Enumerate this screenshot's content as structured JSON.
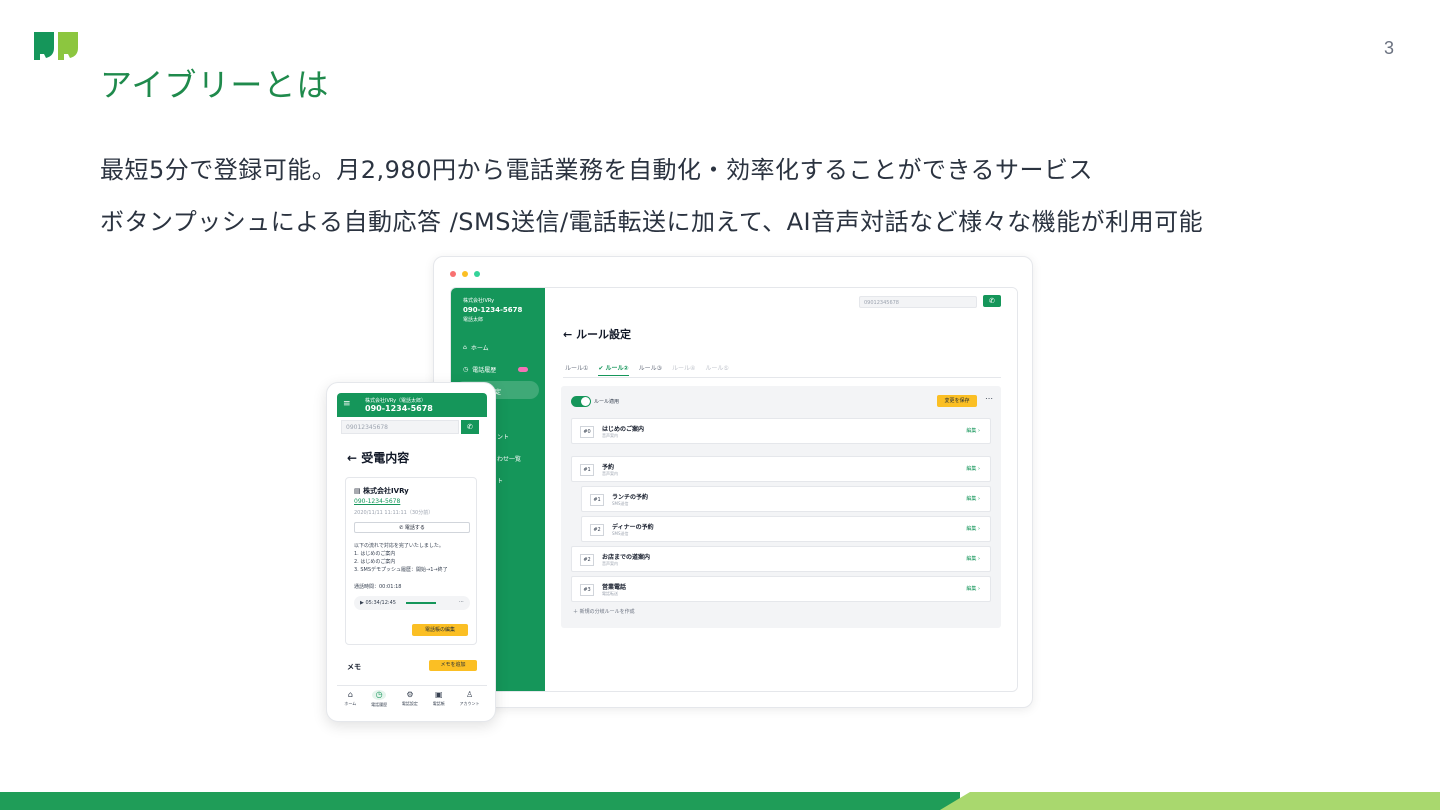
{
  "slide": {
    "page_number": "3",
    "title": "アイブリーとは",
    "line1": "最短5分で登録可能。月2,980円から電話業務を自動化・効率化することができるサービス",
    "line2": "ボタンプッシュによる自動応答 /SMS送信/電話転送に加えて、AI音声対話など様々な機能が利用可能"
  },
  "colors": {
    "brand_green": "#15965a",
    "title_green": "#1f8a4c",
    "accent_yellow": "#fbbf24",
    "footer_light": "#a9d86e"
  },
  "desktop": {
    "sidebar": {
      "company": "株式会社IVRy",
      "phone": "090-1234-5678",
      "user": "電話太郎",
      "items": [
        {
          "label": "ホーム",
          "icon": "home-icon"
        },
        {
          "label": "電話履歴",
          "icon": "clock-icon"
        },
        {
          "label": "定",
          "icon": "gear-icon"
        },
        {
          "label": "ント",
          "icon": ""
        },
        {
          "label": "わせ一覧",
          "icon": ""
        },
        {
          "label": "ト",
          "icon": ""
        }
      ]
    },
    "search_value": "09012345678",
    "page_title": "ルール設定",
    "tabs": [
      "ルール①",
      "ルール②",
      "ルール③",
      "ルール④",
      "ルール⑤"
    ],
    "toggle_label": "ルール適用",
    "save_label": "変更を保存",
    "edit_label": "編集",
    "rules": [
      {
        "num": "#0",
        "title": "はじめのご案内",
        "sub": "音声案内"
      },
      {
        "num": "#1",
        "title": "予約",
        "sub": "音声案内"
      },
      {
        "num": "#1",
        "title": "ランチの予約",
        "sub": "SMS送信"
      },
      {
        "num": "#2",
        "title": "ディナーの予約",
        "sub": "SMS送信"
      },
      {
        "num": "#2",
        "title": "お店までの道案内",
        "sub": "音声案内"
      },
      {
        "num": "#3",
        "title": "営業電話",
        "sub": "電話転送"
      }
    ],
    "add_rule_label": "＋ 新規の分岐ルールを作成"
  },
  "mobile": {
    "company": "株式会社IVRy（電話太郎）",
    "phone": "090-1234-5678",
    "search_value": "09012345678",
    "page_title": "受電内容",
    "card": {
      "company": "株式会社IVRy",
      "number": "090-1234-5678",
      "time": "2020/11/11 11:11:11（30分前）",
      "call_label": "電話する",
      "desc": "以下の流れで対応を完了いたしました。\n1. はじめのご案内\n2. はじめのご案内\n3. SMSデモプッシュ履歴：開始→1→終了",
      "duration": "通話時間：00:01:18",
      "player_time": "05:34/12:45",
      "edit_label": "電話帳の編集"
    },
    "memo_label": "メモ",
    "memo_button": "メモを追加",
    "nav": [
      {
        "label": "ホーム",
        "icon": "home-icon"
      },
      {
        "label": "電話履歴",
        "icon": "clock-icon"
      },
      {
        "label": "電話設定",
        "icon": "gear-icon"
      },
      {
        "label": "電話帳",
        "icon": "phonebook-icon"
      },
      {
        "label": "アカウント",
        "icon": "user-icon"
      }
    ]
  }
}
